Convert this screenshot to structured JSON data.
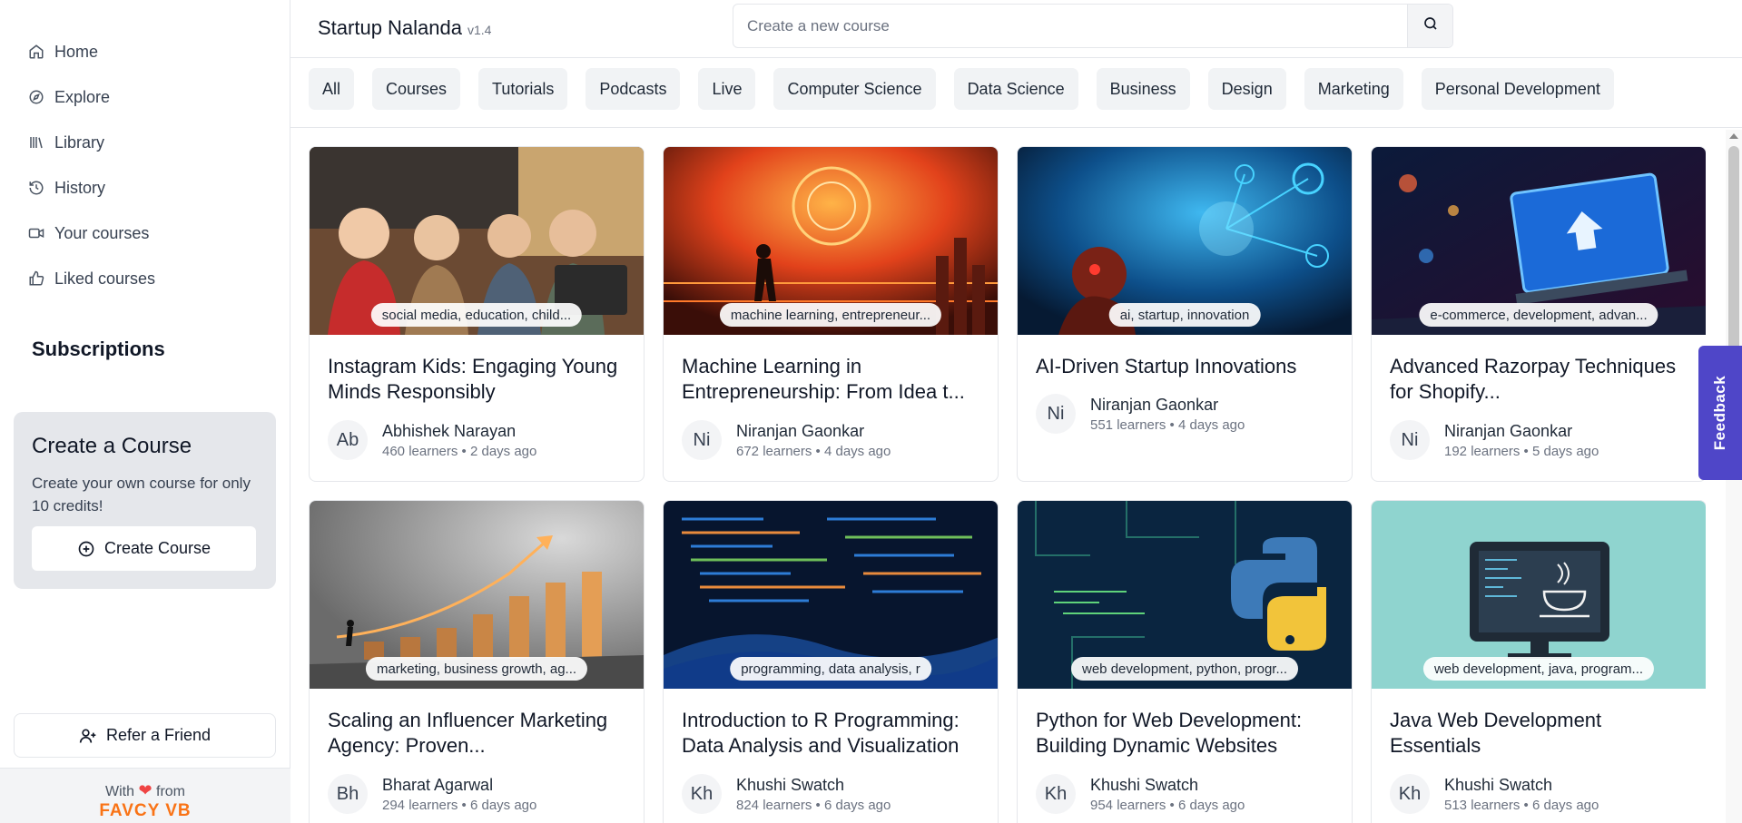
{
  "sidebar": {
    "items": [
      {
        "label": "Home",
        "icon": "home-icon"
      },
      {
        "label": "Explore",
        "icon": "compass-icon"
      },
      {
        "label": "Library",
        "icon": "library-icon"
      },
      {
        "label": "History",
        "icon": "history-icon"
      },
      {
        "label": "Your courses",
        "icon": "video-icon"
      },
      {
        "label": "Liked courses",
        "icon": "thumbs-up-icon"
      }
    ],
    "subscriptions_title": "Subscriptions",
    "create_card": {
      "title": "Create a Course",
      "description": "Create your own course for only 10 credits!",
      "button_label": "Create Course"
    },
    "refer_label": "Refer a Friend",
    "footer": {
      "with": "With",
      "from": "from",
      "brand": "FAVCY VB"
    }
  },
  "header": {
    "brand": "Startup Nalanda",
    "version": "v1.4",
    "search_placeholder": "Create a new course"
  },
  "filters": [
    "All",
    "Courses",
    "Tutorials",
    "Podcasts",
    "Live",
    "Computer Science",
    "Data Science",
    "Business",
    "Design",
    "Marketing",
    "Personal Development"
  ],
  "courses": [
    {
      "title": "Instagram Kids: Engaging Young Minds Responsibly",
      "tags": "social media, education, child...",
      "initials": "Ab",
      "author": "Abhishek Narayan",
      "stats": "460 learners • 2 days ago"
    },
    {
      "title": "Machine Learning in Entrepreneurship: From Idea t...",
      "tags": "machine learning, entrepreneur...",
      "initials": "Ni",
      "author": "Niranjan Gaonkar",
      "stats": "672 learners • 4 days ago"
    },
    {
      "title": "AI-Driven Startup Innovations",
      "tags": "ai, startup, innovation",
      "initials": "Ni",
      "author": "Niranjan Gaonkar",
      "stats": "551 learners • 4 days ago"
    },
    {
      "title": "Advanced Razorpay Techniques for Shopify...",
      "tags": "e-commerce, development, advan...",
      "initials": "Ni",
      "author": "Niranjan Gaonkar",
      "stats": "192 learners • 5 days ago"
    },
    {
      "title": "Scaling an Influencer Marketing Agency: Proven...",
      "tags": "marketing, business growth, ag...",
      "initials": "Bh",
      "author": "Bharat Agarwal",
      "stats": "294 learners • 6 days ago"
    },
    {
      "title": "Introduction to R Programming: Data Analysis and Visualization",
      "tags": "programming, data analysis, r",
      "initials": "Kh",
      "author": "Khushi Swatch",
      "stats": "824 learners • 6 days ago"
    },
    {
      "title": "Python for Web Development: Building Dynamic Websites",
      "tags": "web development, python, progr...",
      "initials": "Kh",
      "author": "Khushi Swatch",
      "stats": "954 learners • 6 days ago"
    },
    {
      "title": "Java Web Development Essentials",
      "tags": "web development, java, program...",
      "initials": "Kh",
      "author": "Khushi Swatch",
      "stats": "513 learners • 6 days ago"
    }
  ],
  "feedback_label": "Feedback",
  "colors": {
    "accent": "#4f46c8",
    "brand_orange": "#f97316",
    "heart": "#ef4444"
  }
}
